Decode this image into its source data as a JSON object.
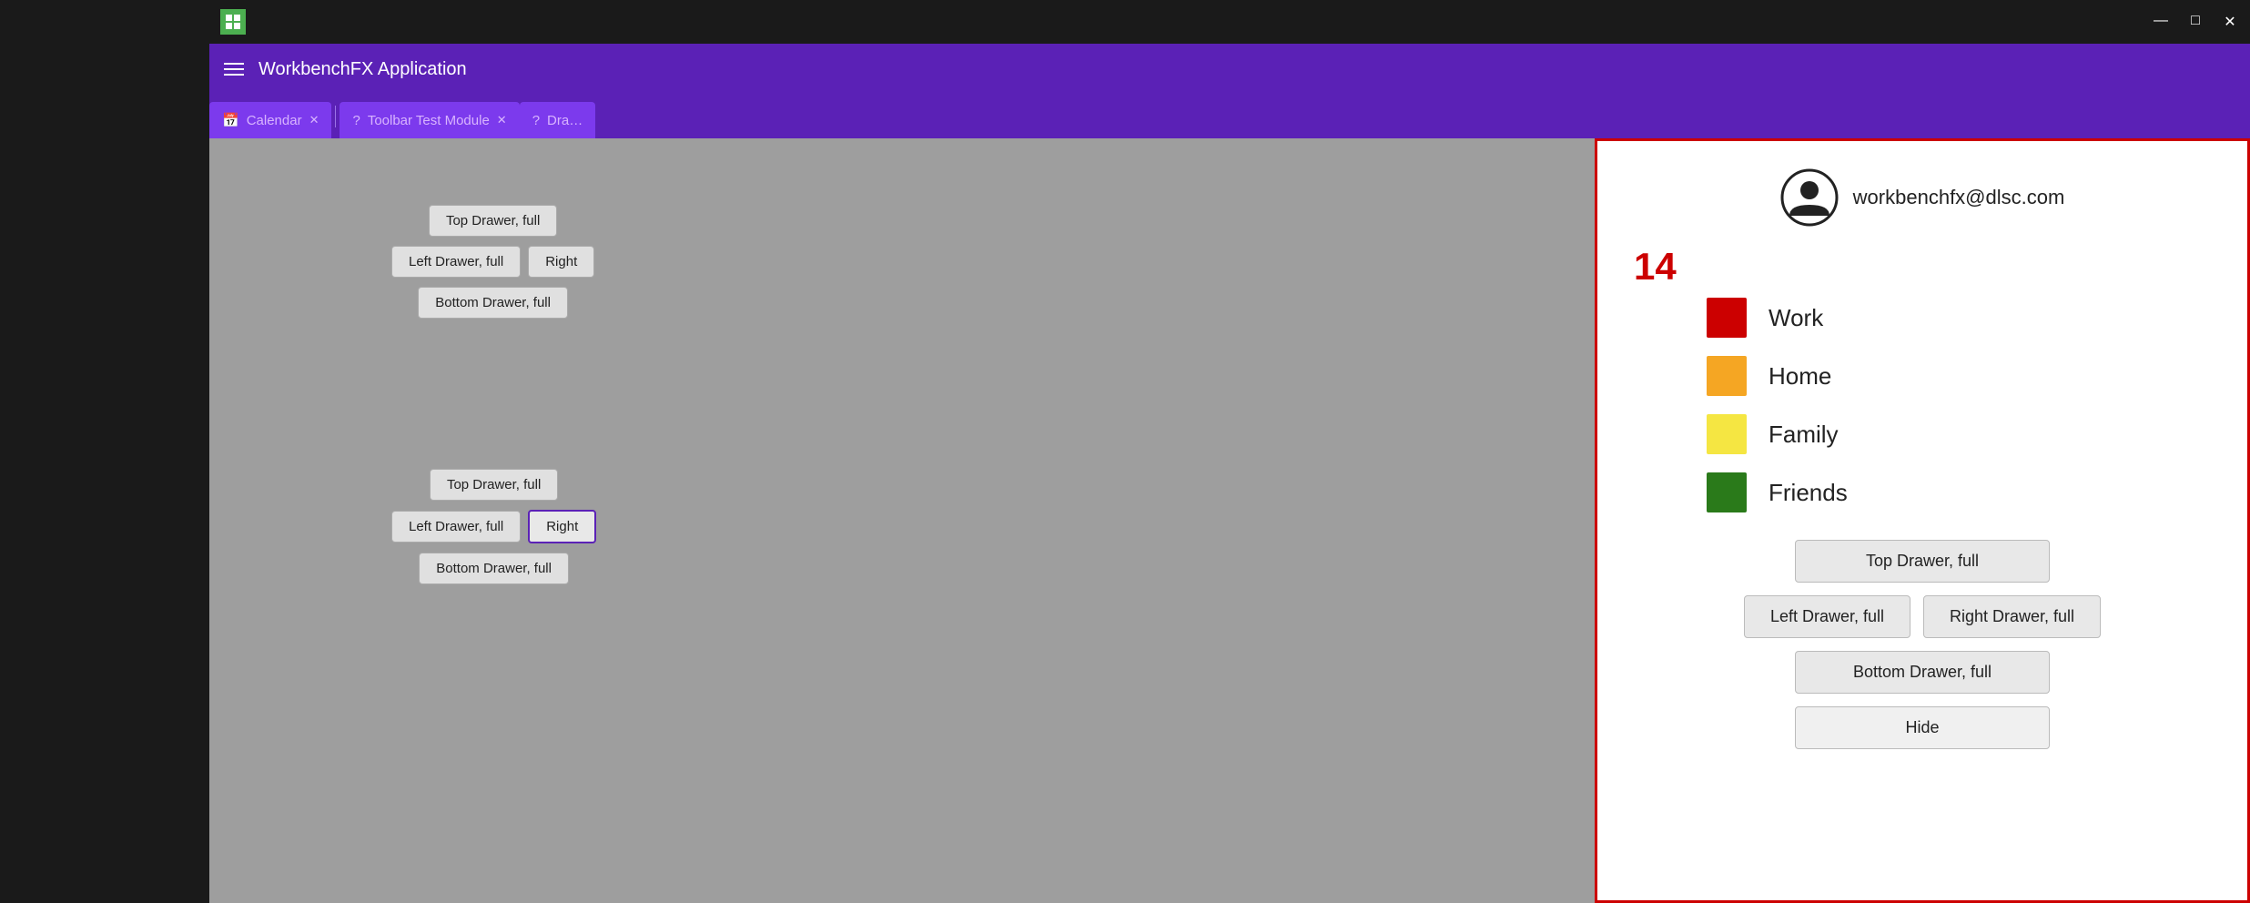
{
  "titlebar": {
    "minimize": "—",
    "maximize": "□",
    "close": "✕"
  },
  "header": {
    "title": "WorkbenchFX Application"
  },
  "tabs": [
    {
      "icon": "📅",
      "label": "Calendar",
      "closable": true
    },
    {
      "icon": "?",
      "label": "Toolbar Test Module",
      "closable": true
    },
    {
      "icon": "?",
      "label": "Dra…",
      "closable": false
    }
  ],
  "drawer_area": {
    "group1": {
      "top_btn": "Top Drawer, full",
      "left_btn": "Left Drawer, full",
      "right_btn": "Right",
      "bottom_btn": "Bottom Drawer, full"
    },
    "group2": {
      "top_btn": "Top Drawer, full",
      "left_btn": "Left Drawer, full",
      "right_btn": "Right",
      "bottom_btn": "Bottom Drawer, full"
    }
  },
  "right_panel": {
    "user_email": "workbenchfx@dlsc.com",
    "badge_count": "14",
    "legend": [
      {
        "color": "#cc0000",
        "label": "Work"
      },
      {
        "color": "#f5a623",
        "label": "Home"
      },
      {
        "color": "#f5e642",
        "label": "Family"
      },
      {
        "color": "#2a7a1a",
        "label": "Friends"
      }
    ],
    "buttons": {
      "top_drawer": "Top Drawer, full",
      "left_drawer": "Left Drawer, full",
      "right_drawer": "Right Drawer, full",
      "bottom_drawer": "Bottom Drawer, full",
      "hide": "Hide"
    }
  }
}
